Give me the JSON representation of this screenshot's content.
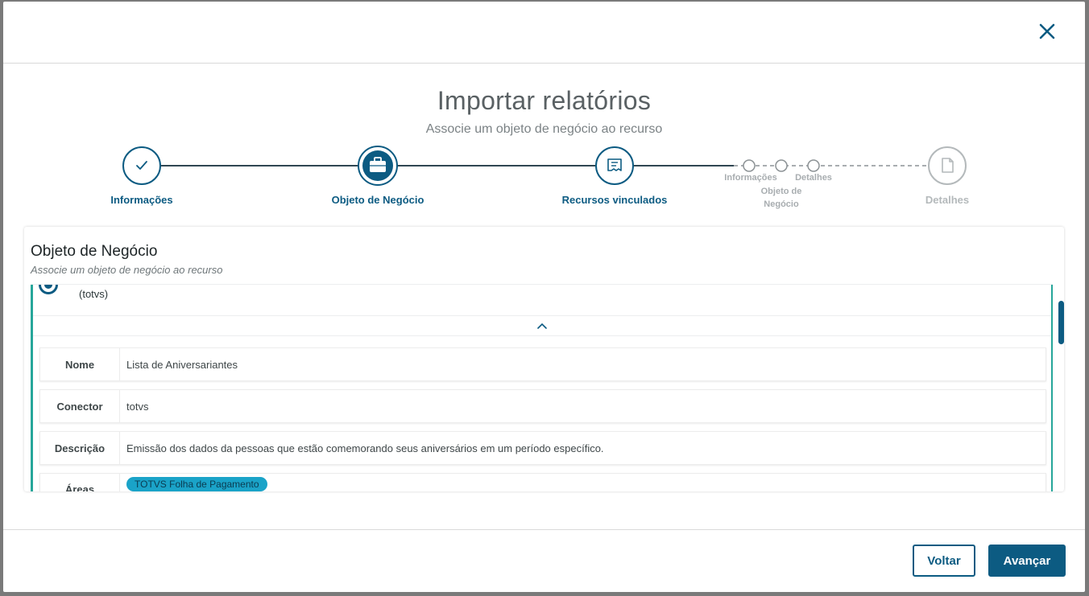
{
  "header": {
    "close_icon": "close-icon"
  },
  "title": "Importar relatórios",
  "subtitle": "Associe um objeto de negócio ao recurso",
  "stepper": {
    "colors": {
      "active": "#0c5b82",
      "inactive": "#b4b9bb"
    },
    "steps": [
      {
        "label": "Informações",
        "icon": "check-icon",
        "state": "done"
      },
      {
        "label": "Objeto de Negócio",
        "icon": "briefcase-icon",
        "state": "current"
      },
      {
        "label": "Recursos vinculados",
        "icon": "receipt-icon",
        "state": "done"
      },
      {
        "label": "Detalhes",
        "icon": "document-icon",
        "state": "pending"
      }
    ],
    "mini_steps": [
      {
        "label": "Informações"
      },
      {
        "label": "Objeto de Negócio"
      },
      {
        "label": "Detalhes"
      }
    ]
  },
  "panel": {
    "title": "Objeto de Negócio",
    "subtitle": "Associe um objeto de negócio ao recurso",
    "option_connector": "(totvs)",
    "details": [
      {
        "key": "Nome",
        "value": "Lista de Aniversariantes"
      },
      {
        "key": "Conector",
        "value": "totvs"
      },
      {
        "key": "Descrição",
        "value": "Emissão dos dados da pessoas que estão comemorando seus aniversários em um período específico."
      },
      {
        "key": "Áreas",
        "tag": "TOTVS Folha de Pagamento"
      }
    ]
  },
  "footer": {
    "back_label": "Voltar",
    "next_label": "Avançar"
  }
}
